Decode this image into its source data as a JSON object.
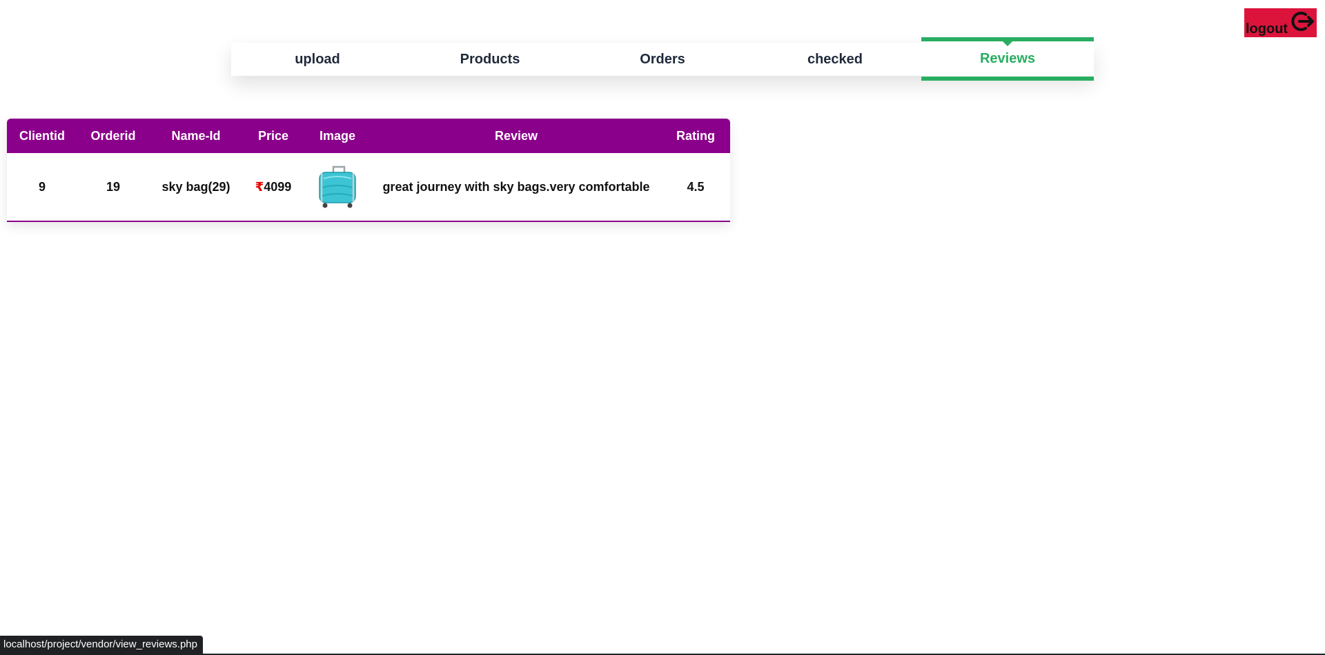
{
  "logout": {
    "label": "logout",
    "icon": "power-logout-icon"
  },
  "nav": {
    "tabs": [
      {
        "label": "upload",
        "active": false
      },
      {
        "label": "Products",
        "active": false
      },
      {
        "label": "Orders",
        "active": false
      },
      {
        "label": "checked",
        "active": false
      },
      {
        "label": "Reviews",
        "active": true
      }
    ]
  },
  "colors": {
    "logout_bg": "#dc143c",
    "active_tab": "#27ae60",
    "table_header": "#8b008b",
    "rupee": "#e60000"
  },
  "table": {
    "headers": [
      "Clientid",
      "Orderid",
      "Name-Id",
      "Price",
      "Image",
      "Review",
      "Rating"
    ],
    "rows": [
      {
        "clientid": "9",
        "orderid": "19",
        "name_id": "sky bag(29)",
        "currency": "₹",
        "price": "4099",
        "image": "suitcase-image",
        "review": "great journey with sky bags.very comfortable",
        "rating": "4.5"
      }
    ]
  },
  "status": {
    "url": "localhost/project/vendor/view_reviews.php"
  }
}
